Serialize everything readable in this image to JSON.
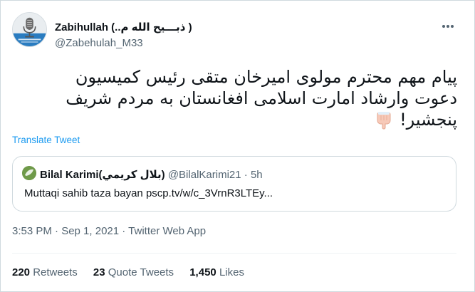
{
  "tweet": {
    "author_name": "Zabihullah (..ذبـــیح الله م )",
    "author_handle": "@Zabehulah_M33",
    "text_line1": "پیام مهم محترم مولوی امیرخان متقی رئیس کمیسیون",
    "text_line2": "دعوت وارشاد امارت اسلامی افغانستان به مردم شریف",
    "text_line3": "پنجشیر!",
    "emoji": "backhand-index-pointing-down-icon",
    "translate_label": "Translate Tweet",
    "timestamp": "3:53 PM · Sep 1, 2021",
    "separator": " · ",
    "source": "Twitter Web App"
  },
  "quoted": {
    "author_name": "Bilal Karimi(بلال كريمي)",
    "author_handle": "@BilalKarimi21",
    "dot": "·",
    "time": "5h",
    "text": "Muttaqi sahib taza bayan pscp.tv/w/c_3VrnR3LTEy..."
  },
  "stats": {
    "retweets_count": "220",
    "retweets_label": "Retweets",
    "quotes_count": "23",
    "quotes_label": "Quote Tweets",
    "likes_count": "1,450",
    "likes_label": "Likes"
  },
  "colors": {
    "accent": "#1d9bf0",
    "secondary_text": "#536471",
    "border": "#cfd9de"
  }
}
